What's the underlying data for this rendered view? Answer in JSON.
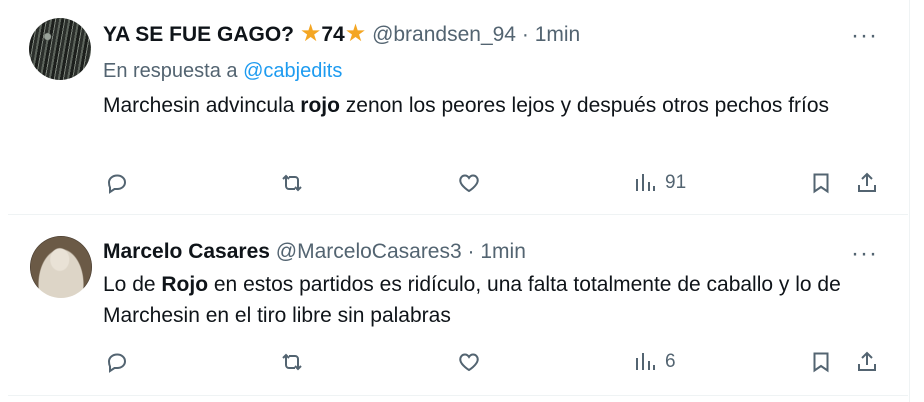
{
  "tweets": [
    {
      "name": "YA SE FUE GAGO?",
      "badge_number": "74",
      "handle": "@brandsen_94",
      "time": "1min",
      "reply_prefix": "En respuesta a",
      "reply_mention": "@cabjedits",
      "body_pre": "Marchesin advincula ",
      "body_bold": "rojo",
      "body_post": " zenon los peores lejos y después otros pechos fríos",
      "views": "91",
      "more": "···"
    },
    {
      "name": "Marcelo Casares",
      "handle": "@MarceloCasares3",
      "time": "1min",
      "body_pre": "Lo de ",
      "body_bold": "Rojo",
      "body_post": " en estos partidos es ridículo, una falta totalmente de caballo y lo de Marchesin en el tiro libre sin palabras",
      "views": "6",
      "more": "···"
    }
  ],
  "icons": {
    "star": "★",
    "dot": "·"
  },
  "colors": {
    "text": "#0f1419",
    "secondary": "#536471",
    "link": "#1d9bf0",
    "star": "#f4a623"
  }
}
